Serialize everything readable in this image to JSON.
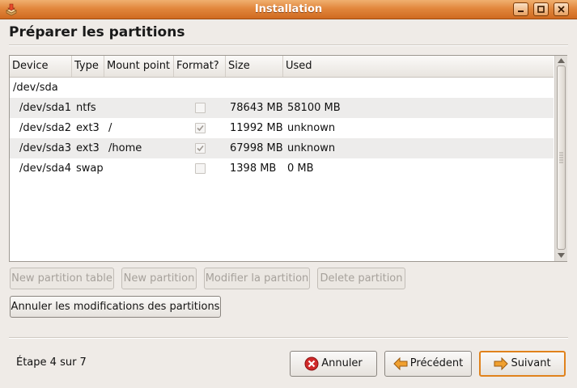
{
  "window": {
    "title": "Installation",
    "icon": "installer-package-icon",
    "controls": [
      "minimize-icon",
      "maximize-icon",
      "close-icon"
    ]
  },
  "page": {
    "title": "Préparer les partitions"
  },
  "table": {
    "headers": [
      "Device",
      "Type",
      "Mount point",
      "Format?",
      "Size",
      "Used"
    ],
    "disk": "/dev/sda",
    "rows": [
      {
        "device": "/dev/sda1",
        "type": "ntfs",
        "mount": "",
        "format": false,
        "size": "78643 MB",
        "used": "58100 MB"
      },
      {
        "device": "/dev/sda2",
        "type": "ext3",
        "mount": "/",
        "format": true,
        "size": "11992 MB",
        "used": "unknown"
      },
      {
        "device": "/dev/sda3",
        "type": "ext3",
        "mount": "/home",
        "format": true,
        "size": "67998 MB",
        "used": "unknown"
      },
      {
        "device": "/dev/sda4",
        "type": "swap",
        "mount": "",
        "format": false,
        "size": "1398 MB",
        "used": "0 MB"
      }
    ]
  },
  "actions": {
    "new_table": "New partition table",
    "new_partition": "New partition",
    "modify": "Modifier la partition",
    "delete": "Delete partition",
    "revert": "Annuler les modifications des partitions"
  },
  "footer": {
    "step": "Étape 4 sur 7",
    "cancel": "Annuler",
    "back": "Précédent",
    "next": "Suivant"
  },
  "colors": {
    "titlebar": "#e2873d",
    "default_button_border": "#e0821c",
    "cancel_icon": "#d02a2a",
    "arrow_icon": "#f0a030"
  }
}
